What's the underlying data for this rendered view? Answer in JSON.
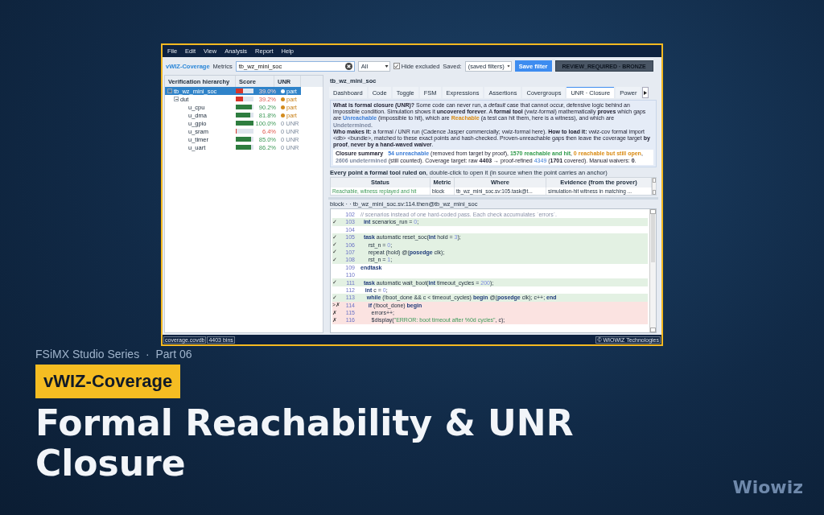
{
  "window": {
    "menu": [
      "File",
      "Edit",
      "View",
      "Analysis",
      "Report",
      "Help"
    ],
    "toolbar": {
      "app_label": "vWIZ-Coverage",
      "metrics_label": "Metrics",
      "search_value": "tb_wz_mini_soc",
      "scope_select": "All",
      "hide_excluded": {
        "label": "Hide excluded",
        "checked": true
      },
      "saved_label": "Saved:",
      "saved_select": "(saved filters)",
      "save_button": "Save filter",
      "review_badge": "REVIEW_REQUIRED · BRONZE"
    },
    "hierarchy": {
      "columns": [
        "Verification hierarchy",
        "Score",
        "UNR"
      ],
      "items": [
        {
          "name": "tb_wz_mini_soc",
          "score": "39.0%",
          "level": 0.39,
          "unr": "part",
          "partial": true,
          "selected": true,
          "expanded": true,
          "children": [
            {
              "name": "dut",
              "score": "39.2%",
              "level": 0.392,
              "unr": "part",
              "partial": true,
              "selected": false,
              "expanded": true,
              "children": [
                {
                  "name": "u_cpu",
                  "score": "90.2%",
                  "level": 0.902,
                  "unr": "part",
                  "partial": true,
                  "selected": false
                },
                {
                  "name": "u_dma",
                  "score": "81.8%",
                  "level": 0.818,
                  "unr": "part",
                  "partial": true,
                  "selected": false
                },
                {
                  "name": "u_gpio",
                  "score": "100.0%",
                  "level": 1,
                  "unr": "0 UNR",
                  "partial": false,
                  "selected": false
                },
                {
                  "name": "u_sram",
                  "score": "6.4%",
                  "level": 0.064,
                  "unr": "0 UNR",
                  "partial": false,
                  "selected": false
                },
                {
                  "name": "u_timer",
                  "score": "85.0%",
                  "level": 0.85,
                  "unr": "0 UNR",
                  "partial": false,
                  "selected": false
                },
                {
                  "name": "u_uart",
                  "score": "86.2%",
                  "level": 0.862,
                  "unr": "0 UNR",
                  "partial": false,
                  "selected": false
                }
              ]
            }
          ]
        }
      ]
    },
    "detail": {
      "title": "tb_wz_mini_soc",
      "tabs": [
        {
          "label": "Dashboard",
          "selected": false
        },
        {
          "label": "Code",
          "selected": false
        },
        {
          "label": "Toggle",
          "selected": false
        },
        {
          "label": "FSM",
          "selected": false
        },
        {
          "label": "Expressions",
          "selected": false
        },
        {
          "label": "Assertions",
          "selected": false
        },
        {
          "label": "Covergroups",
          "selected": false
        },
        {
          "label": "UNR · Closure",
          "selected": true
        },
        {
          "label": "Power",
          "selected": false
        }
      ],
      "info": [
        [
          {
            "kind": "bold",
            "text": "What is formal closure (UNR)?"
          },
          {
            "kind": "plain",
            "text": " Some code can never run, a "
          },
          {
            "kind": "italic",
            "text": "default"
          },
          {
            "kind": "plain",
            "text": " case that cannot occur, defensive logic behind an impossible condition. Simulation shows it "
          },
          {
            "kind": "bold",
            "text": "uncovered forever"
          },
          {
            "kind": "plain",
            "text": ". A "
          },
          {
            "kind": "bold",
            "text": "formal tool"
          },
          {
            "kind": "plain",
            "text": " (vwiz-formal) mathematically "
          },
          {
            "kind": "bold",
            "text": "proves"
          },
          {
            "kind": "plain",
            "text": " which gaps are "
          },
          {
            "kind": "unreachable",
            "text": "Unreachable"
          },
          {
            "kind": "plain",
            "text": " (impossible to hit), which are "
          },
          {
            "kind": "reachable",
            "text": "Reachable"
          },
          {
            "kind": "plain",
            "text": " (a test can hit them, here is a witness), and which are "
          },
          {
            "kind": "undetermined",
            "text": "Undetermined"
          },
          {
            "kind": "plain",
            "text": "."
          }
        ],
        [
          {
            "kind": "bold",
            "text": "Who makes it:"
          },
          {
            "kind": "plain",
            "text": " a formal / UNR run (Cadence Jasper commercially; vwiz-formal here).  "
          },
          {
            "kind": "bold",
            "text": "How to load it:"
          },
          {
            "kind": "plain",
            "text": " vwiz-cov formal import <db> <bundle>, matched to these exact points and hash-checked.  Proven-unreachable gaps then leave the coverage target "
          },
          {
            "kind": "bold",
            "text": "by proof"
          },
          {
            "kind": "plain",
            "text": ", "
          },
          {
            "kind": "bold",
            "text": "never by a hand-waved waiver"
          },
          {
            "kind": "plain",
            "text": "."
          }
        ]
      ],
      "summary": [
        {
          "kind": "heading",
          "text": "Closure summary"
        },
        {
          "kind": "unreachable",
          "text": "54 unreachable"
        },
        {
          "kind": "plain",
          "text": " (removed from target by proof), "
        },
        {
          "kind": "hit",
          "text": "1570 reachable and hit"
        },
        {
          "kind": "plain",
          "text": ", "
        },
        {
          "kind": "reachable",
          "text": "0 reachable but still open"
        },
        {
          "kind": "plain",
          "text": ", "
        },
        {
          "kind": "undetermined",
          "text": "2606 undetermined"
        },
        {
          "kind": "plain",
          "text": " (still counted).  Coverage target: raw "
        },
        {
          "kind": "bold",
          "text": "4403"
        },
        {
          "kind": "plain",
          "text": " → proof-refined "
        },
        {
          "kind": "link",
          "text": "4349"
        },
        {
          "kind": "plain",
          "text": " ("
        },
        {
          "kind": "bold",
          "text": "1701"
        },
        {
          "kind": "plain",
          "text": " covered). Manual waivers: "
        },
        {
          "kind": "bold",
          "text": "0"
        },
        {
          "kind": "plain",
          "text": "."
        }
      ],
      "points_heading": "**Every point a formal tool ruled on**, double-click to open it (in source when the point carries an anchor)",
      "points_table": {
        "columns": [
          "Status",
          "Metric",
          "Where",
          "Evidence (from the prover)"
        ],
        "rows": [
          {
            "status": "Reachable, witness replayed and hit",
            "metric": "block",
            "where": "tb_wz_mini_soc.sv:105.task@t...",
            "evidence": "simulation-hit witness in matching ..."
          }
        ]
      },
      "source_header": "block · · tb_wz_mini_soc.sv:114.then@tb_wz_mini_soc",
      "source_lines": [
        {
          "number": "102",
          "kind": "plain",
          "code": [
            {
              "kind": "comment",
              "text": "// scenarios instead of one hard-coded pass. Each check accumulates `errors`."
            }
          ]
        },
        {
          "mark": "✓",
          "number": "103",
          "kind": "hit",
          "code": [
            {
              "kind": "keyword",
              "text": "  int"
            },
            {
              "kind": "plain",
              "text": " scenarios_run = "
            },
            {
              "kind": "number",
              "text": "0"
            },
            {
              "kind": "plain",
              "text": ";"
            }
          ]
        },
        {
          "number": "104",
          "kind": "plain"
        },
        {
          "mark": "✓",
          "number": "105",
          "kind": "hit",
          "code": [
            {
              "kind": "keyword",
              "text": "  task"
            },
            {
              "kind": "plain",
              "text": " automatic reset_soc("
            },
            {
              "kind": "keyword",
              "text": "int"
            },
            {
              "kind": "plain",
              "text": " hold = "
            },
            {
              "kind": "number",
              "text": "3"
            },
            {
              "kind": "plain",
              "text": ");"
            }
          ]
        },
        {
          "mark": "✓",
          "number": "106",
          "kind": "hit",
          "code": [
            {
              "kind": "plain",
              "text": "     rst_n = "
            },
            {
              "kind": "number",
              "text": "0"
            },
            {
              "kind": "plain",
              "text": ";"
            }
          ]
        },
        {
          "mark": "✓",
          "number": "107",
          "kind": "hit",
          "code": [
            {
              "kind": "plain",
              "text": "     repeat (hold) @("
            },
            {
              "kind": "keyword",
              "text": "posedge"
            },
            {
              "kind": "plain",
              "text": " clk);"
            }
          ]
        },
        {
          "mark": "✓",
          "number": "108",
          "kind": "hit",
          "code": [
            {
              "kind": "plain",
              "text": "     rst_n = "
            },
            {
              "kind": "number",
              "text": "1"
            },
            {
              "kind": "plain",
              "text": ";"
            }
          ]
        },
        {
          "number": "109",
          "kind": "plain",
          "code": [
            {
              "kind": "keyword",
              "text": "endtask"
            }
          ]
        },
        {
          "number": "110",
          "kind": "plain"
        },
        {
          "mark": "✓",
          "number": "111",
          "kind": "hit",
          "code": [
            {
              "kind": "keyword",
              "text": "  task"
            },
            {
              "kind": "plain",
              "text": " automatic wait_boot("
            },
            {
              "kind": "keyword",
              "text": "int"
            },
            {
              "kind": "plain",
              "text": " timeout_cycles = "
            },
            {
              "kind": "number",
              "text": "200"
            },
            {
              "kind": "plain",
              "text": ");"
            }
          ]
        },
        {
          "number": "112",
          "kind": "plain",
          "code": [
            {
              "kind": "keyword",
              "text": "   int"
            },
            {
              "kind": "plain",
              "text": " c = "
            },
            {
              "kind": "number",
              "text": "0"
            },
            {
              "kind": "plain",
              "text": ";"
            }
          ]
        },
        {
          "mark": "✓",
          "number": "113",
          "kind": "hit",
          "code": [
            {
              "kind": "keyword",
              "text": "    while"
            },
            {
              "kind": "plain",
              "text": " (!boot_done && c < timeout_cycles) "
            },
            {
              "kind": "keyword",
              "text": "begin"
            },
            {
              "kind": "plain",
              "text": " @("
            },
            {
              "kind": "keyword",
              "text": "posedge"
            },
            {
              "kind": "plain",
              "text": " clk); c++; "
            },
            {
              "kind": "keyword",
              "text": "end"
            }
          ]
        },
        {
          "mark": ">✗",
          "number": "114",
          "kind": "miss",
          "code": [
            {
              "kind": "keyword",
              "text": "     if"
            },
            {
              "kind": "plain",
              "text": " (!boot_done) "
            },
            {
              "kind": "keyword",
              "text": "begin"
            }
          ]
        },
        {
          "mark": "✗",
          "number": "115",
          "kind": "miss",
          "code": [
            {
              "kind": "plain",
              "text": "       errors++;"
            }
          ]
        },
        {
          "mark": "✗",
          "number": "116",
          "kind": "miss",
          "code": [
            {
              "kind": "plain",
              "text": "       $display("
            },
            {
              "kind": "string",
              "text": "\"ERROR: boot timeout after %0d cycles\""
            },
            {
              "kind": "plain",
              "text": ", c);"
            }
          ]
        }
      ]
    },
    "status_bar": {
      "file": "coverage.covdb",
      "bins": "4403 bins",
      "copyright": "© WIOWIZ Technologies"
    }
  },
  "series_line": "FSiMX Studio Series  ·  Part 06",
  "product_badge": "vWIZ-Coverage",
  "headline": "Formal Reachability & UNR Closure",
  "brand": "Wiowiz"
}
